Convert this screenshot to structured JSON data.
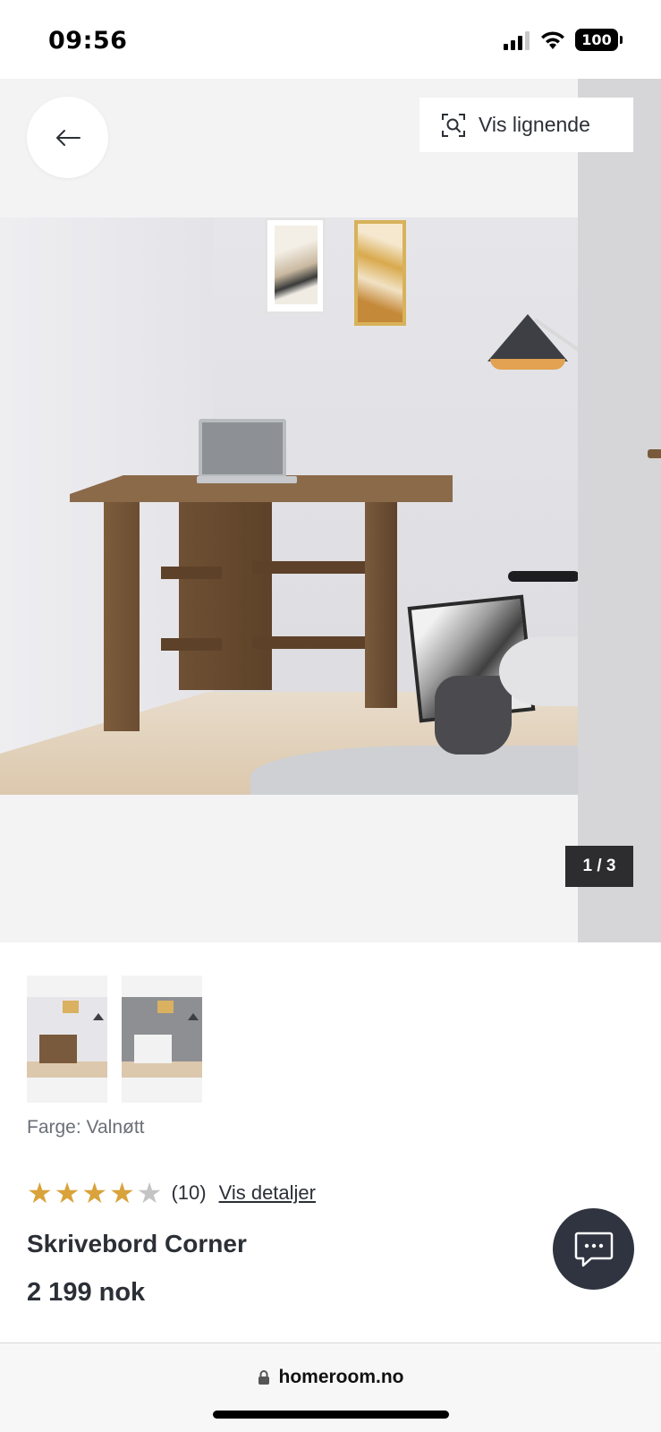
{
  "status_bar": {
    "time": "09:56",
    "battery": "100",
    "icons": [
      "signal-icon",
      "wifi-icon",
      "battery-icon"
    ]
  },
  "gallery": {
    "back_icon": "arrow-left-icon",
    "similar_button": {
      "label": "Vis lignende",
      "icon": "visual-search-icon"
    },
    "counter": "1 / 3"
  },
  "thumbnails": [
    {
      "name": "thumbnail-walnut",
      "wall": "#e6e6ea",
      "desk": "#7a5a3c"
    },
    {
      "name": "thumbnail-white",
      "wall": "#8e8f93",
      "desk": "#f2f2f2"
    }
  ],
  "product": {
    "color_label": "Farge: Valnøtt",
    "rating": {
      "value": 4,
      "max": 5,
      "count_label": "(10)",
      "details_link": "Vis detaljer"
    },
    "title": "Skrivebord Corner",
    "price": "2 199 nok"
  },
  "chat": {
    "icon": "chat-bubble-icon"
  },
  "browser": {
    "url": "homeroom.no",
    "lock_icon": "lock-icon"
  },
  "colors": {
    "star_filled": "#d9a23b",
    "star_empty": "#c4c4c4",
    "text_dark": "#2b2f36",
    "chat_bg": "#2f3440"
  }
}
